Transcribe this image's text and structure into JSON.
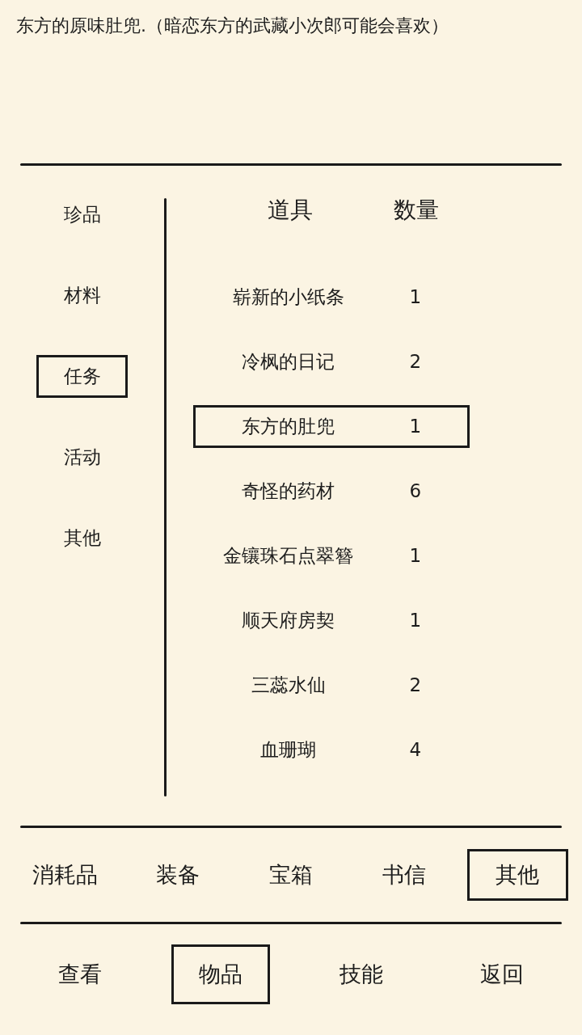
{
  "description": "东方的原味肚兜.（暗恋东方的武藏小次郎可能会喜欢）",
  "categories": [
    {
      "label": "珍品",
      "selected": false
    },
    {
      "label": "材料",
      "selected": false
    },
    {
      "label": "任务",
      "selected": true
    },
    {
      "label": "活动",
      "selected": false
    },
    {
      "label": "其他",
      "selected": false
    }
  ],
  "table": {
    "columns": [
      "道具",
      "数量"
    ],
    "rows": [
      {
        "name": "崭新的小纸条",
        "count": "1",
        "selected": false
      },
      {
        "name": "冷枫的日记",
        "count": "2",
        "selected": false
      },
      {
        "name": "东方的肚兜",
        "count": "1",
        "selected": true
      },
      {
        "name": "奇怪的药材",
        "count": "6",
        "selected": false
      },
      {
        "name": "金镶珠石点翠簪",
        "count": "1",
        "selected": false
      },
      {
        "name": "顺天府房契",
        "count": "1",
        "selected": false
      },
      {
        "name": "三蕊水仙",
        "count": "2",
        "selected": false
      },
      {
        "name": "血珊瑚",
        "count": "4",
        "selected": false
      }
    ]
  },
  "tabs": [
    {
      "label": "消耗品",
      "selected": false
    },
    {
      "label": "装备",
      "selected": false
    },
    {
      "label": "宝箱",
      "selected": false
    },
    {
      "label": "书信",
      "selected": false
    },
    {
      "label": "其他",
      "selected": true
    }
  ],
  "nav": [
    {
      "label": "查看",
      "selected": false
    },
    {
      "label": "物品",
      "selected": true
    },
    {
      "label": "技能",
      "selected": false
    },
    {
      "label": "返回",
      "selected": false
    }
  ]
}
